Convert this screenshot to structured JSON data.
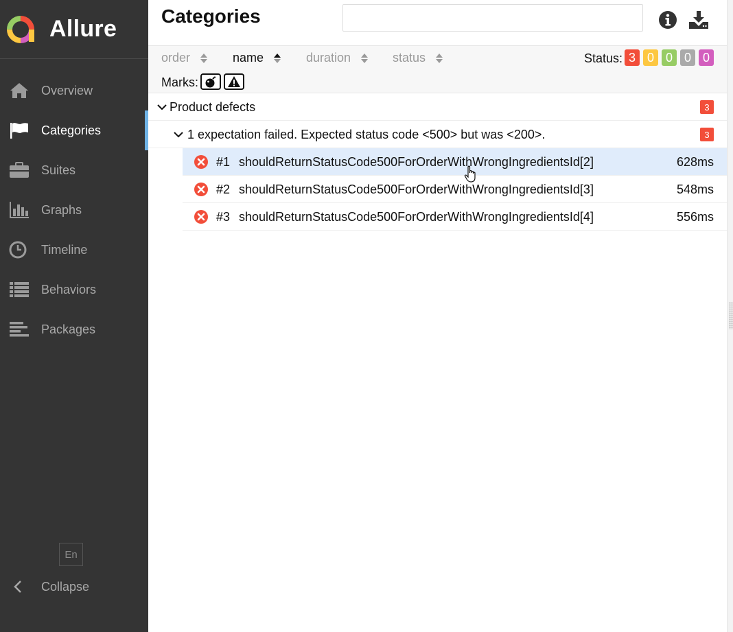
{
  "app": {
    "name": "Allure"
  },
  "sidebar": {
    "items": [
      {
        "label": "Overview",
        "icon": "home-icon"
      },
      {
        "label": "Categories",
        "icon": "flag-icon",
        "active": true
      },
      {
        "label": "Suites",
        "icon": "briefcase-icon"
      },
      {
        "label": "Graphs",
        "icon": "bar-chart-icon"
      },
      {
        "label": "Timeline",
        "icon": "clock-icon"
      },
      {
        "label": "Behaviors",
        "icon": "list-icon"
      },
      {
        "label": "Packages",
        "icon": "align-left-icon"
      }
    ],
    "language": "En",
    "collapse_label": "Collapse"
  },
  "header": {
    "title": "Categories",
    "search": {
      "value": "",
      "placeholder": ""
    }
  },
  "toolbar": {
    "sorters": [
      {
        "label": "order",
        "active": false
      },
      {
        "label": "name",
        "active": true
      },
      {
        "label": "duration",
        "active": false
      },
      {
        "label": "status",
        "active": false
      }
    ],
    "status_label": "Status:",
    "status_counts": [
      {
        "value": "3",
        "color": "#f24e3a"
      },
      {
        "value": "0",
        "color": "#fdc741"
      },
      {
        "value": "0",
        "color": "#97cc64"
      },
      {
        "value": "0",
        "color": "#aaaaaa"
      },
      {
        "value": "0",
        "color": "#d35ebe"
      }
    ],
    "marks_label": "Marks:",
    "marks": [
      "bomb-icon",
      "warning-icon"
    ]
  },
  "tree": {
    "category": {
      "title": "Product defects",
      "count": "3"
    },
    "subcategory": {
      "title": "1 expectation failed. Expected status code <500> but was <200>.",
      "count": "3"
    },
    "tests": [
      {
        "num": "#1",
        "name": "shouldReturnStatusCode500ForOrderWithWrongIngredientsId[2]",
        "duration": "628ms",
        "selected": true
      },
      {
        "num": "#2",
        "name": "shouldReturnStatusCode500ForOrderWithWrongIngredientsId[3]",
        "duration": "548ms"
      },
      {
        "num": "#3",
        "name": "shouldReturnStatusCode500ForOrderWithWrongIngredientsId[4]",
        "duration": "556ms"
      }
    ]
  },
  "colors": {
    "sidebar_bg": "#343434",
    "active_accent": "#6fb3e6",
    "failed": "#f24e3a",
    "selected_row": "#e0ecfb"
  }
}
